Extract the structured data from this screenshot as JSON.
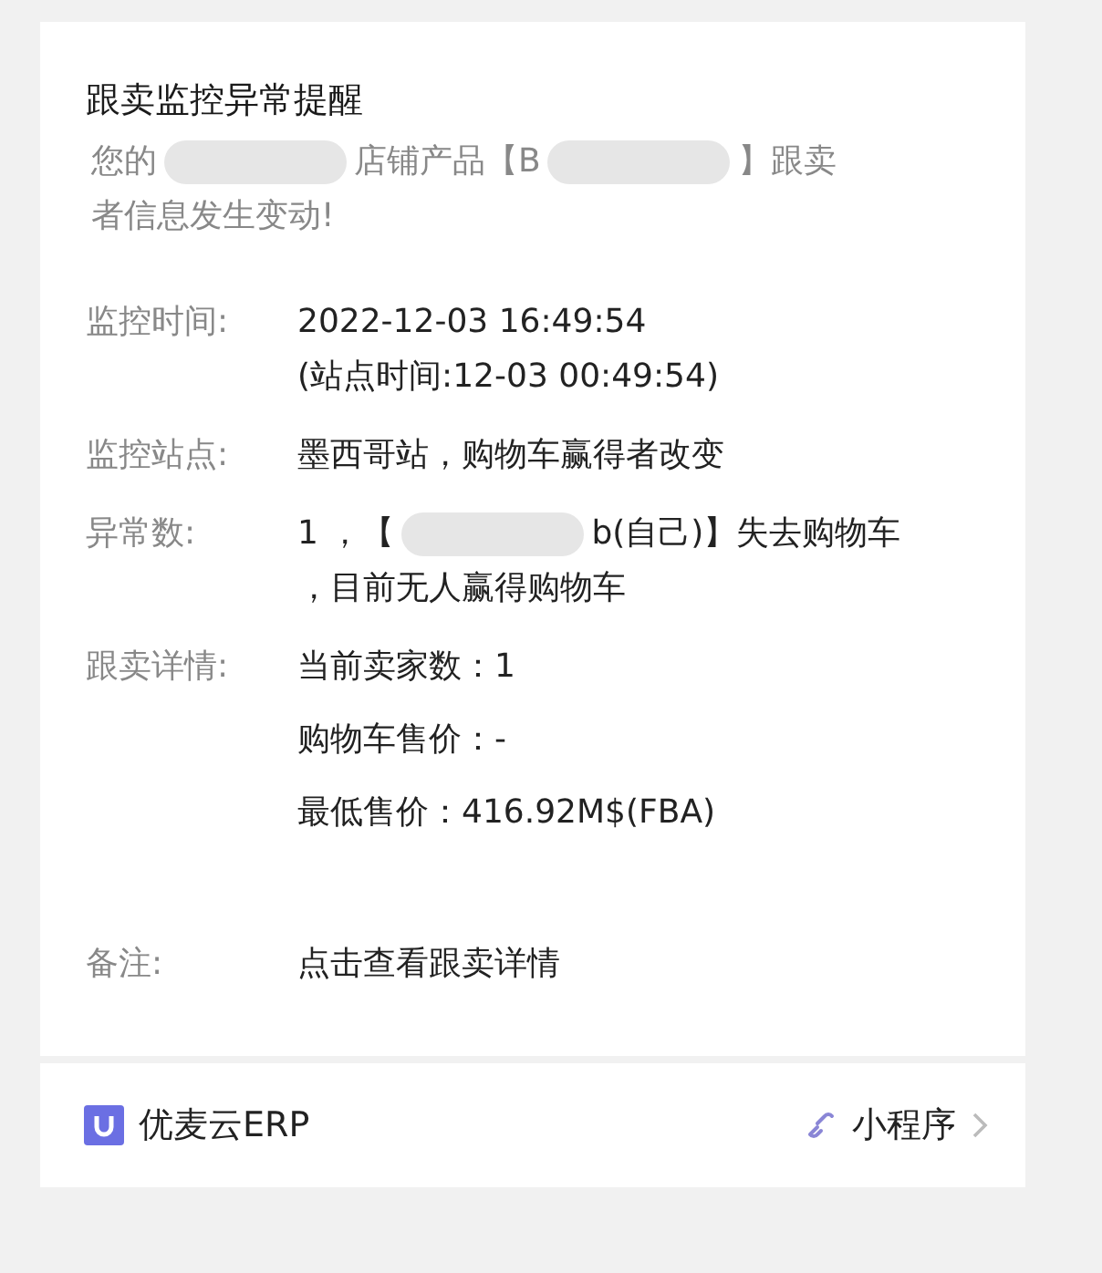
{
  "title": "跟卖监控异常提醒",
  "intro": [
    {
      "kind": "text",
      "text": "您的"
    },
    {
      "kind": "redacted"
    },
    {
      "kind": "text",
      "text": "店铺产品【B"
    },
    {
      "kind": "redacted"
    },
    {
      "kind": "text",
      "text": "】跟卖"
    },
    {
      "kind": "break"
    },
    {
      "kind": "text",
      "text": "者信息发生变动!"
    }
  ],
  "fields": [
    {
      "label": "监控时间:",
      "value": [
        {
          "kind": "text",
          "text": "2022-12-03 16:49:54"
        },
        {
          "kind": "break"
        },
        {
          "kind": "text",
          "text": "(站点时间:12-03 00:49:54)"
        }
      ]
    },
    {
      "label": "监控站点:",
      "value": [
        {
          "kind": "text",
          "text": "墨西哥站，购物车赢得者改变"
        }
      ]
    },
    {
      "label": "异常数:",
      "value": [
        {
          "kind": "text",
          "text": "1 ，【"
        },
        {
          "kind": "redacted"
        },
        {
          "kind": "text",
          "text": "b(自己)】失去购物车"
        },
        {
          "kind": "break"
        },
        {
          "kind": "text",
          "text": "，目前无人赢得购物车"
        }
      ]
    },
    {
      "label": "跟卖详情:",
      "value": [
        {
          "kind": "text",
          "text": "当前卖家数：1"
        },
        {
          "kind": "gap"
        },
        {
          "kind": "text",
          "text": "购物车售价：-"
        },
        {
          "kind": "gap"
        },
        {
          "kind": "text",
          "text": "最低售价：416.92M$(FBA)"
        },
        {
          "kind": "gap"
        }
      ]
    },
    {
      "label": "备注:",
      "value": [
        {
          "kind": "text",
          "text": "点击查看跟卖详情"
        }
      ]
    }
  ],
  "footer": {
    "brand": "优麦云ERP",
    "link": "小程序"
  }
}
